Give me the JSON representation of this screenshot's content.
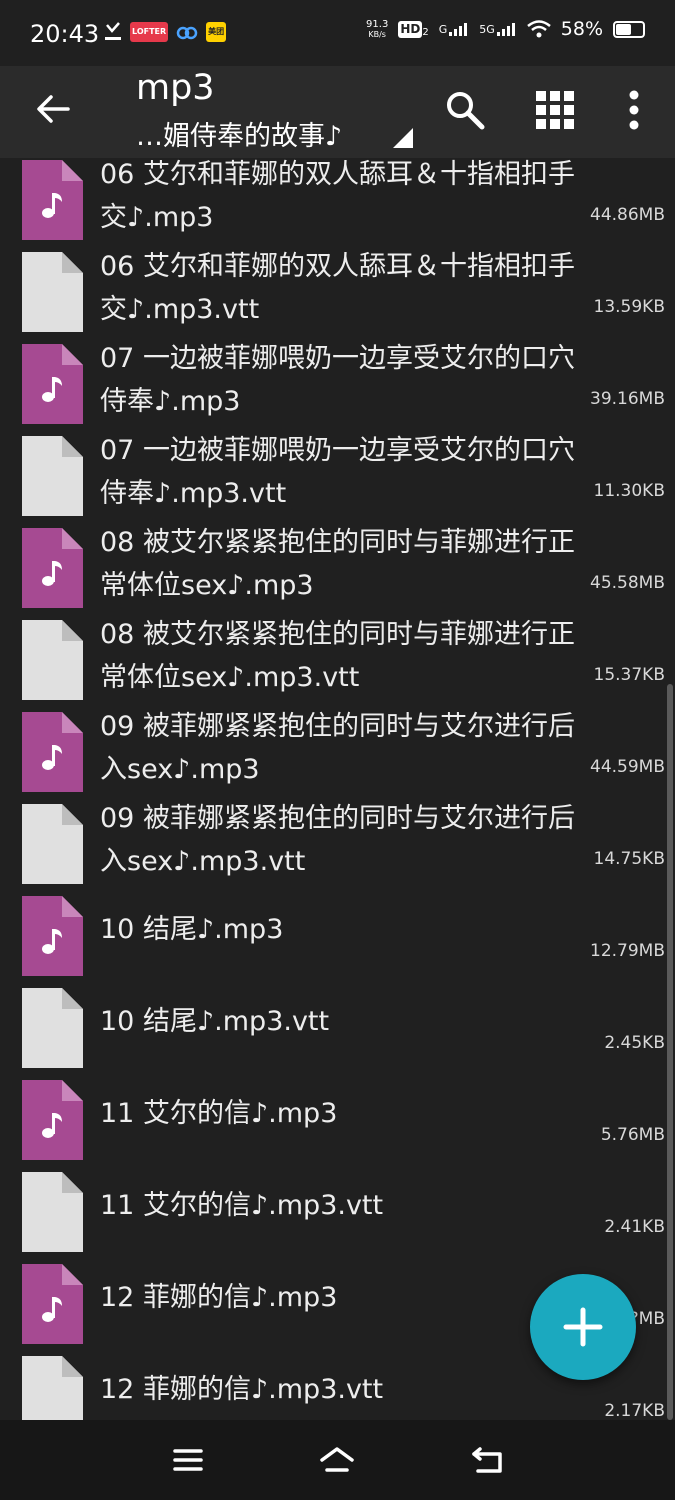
{
  "status_bar": {
    "time": "20:43",
    "net_speed_value": "91.3",
    "net_speed_unit": "KB/s",
    "hd_label": "HD",
    "hd_sub": "2",
    "sig1_label": "G",
    "sig2_label": "5G",
    "battery_percent": "58%",
    "battery_level": 0.58,
    "badges": [
      "LOFTER",
      "美团"
    ]
  },
  "app_bar": {
    "title": "mp3",
    "subtitle": "…媚侍奉的故事♪"
  },
  "files": [
    {
      "name": "06 艾尔和菲娜的双人舔耳＆十指相扣手交♪.mp3",
      "size": "44.86MB",
      "type": "audio"
    },
    {
      "name": "06 艾尔和菲娜的双人舔耳＆十指相扣手交♪.mp3.vtt",
      "size": "13.59KB",
      "type": "document"
    },
    {
      "name": "07 一边被菲娜喂奶一边享受艾尔的口穴侍奉♪.mp3",
      "size": "39.16MB",
      "type": "audio"
    },
    {
      "name": "07 一边被菲娜喂奶一边享受艾尔的口穴侍奉♪.mp3.vtt",
      "size": "11.30KB",
      "type": "document"
    },
    {
      "name": "08 被艾尔紧紧抱住的同时与菲娜进行正常体位sex♪.mp3",
      "size": "45.58MB",
      "type": "audio"
    },
    {
      "name": "08 被艾尔紧紧抱住的同时与菲娜进行正常体位sex♪.mp3.vtt",
      "size": "15.37KB",
      "type": "document"
    },
    {
      "name": "09 被菲娜紧紧抱住的同时与艾尔进行后入sex♪.mp3",
      "size": "44.59MB",
      "type": "audio"
    },
    {
      "name": "09 被菲娜紧紧抱住的同时与艾尔进行后入sex♪.mp3.vtt",
      "size": "14.75KB",
      "type": "document"
    },
    {
      "name": "10 结尾♪.mp3",
      "size": "12.79MB",
      "type": "audio"
    },
    {
      "name": "10 结尾♪.mp3.vtt",
      "size": "2.45KB",
      "type": "document"
    },
    {
      "name": "11 艾尔的信♪.mp3",
      "size": "5.76MB",
      "type": "audio"
    },
    {
      "name": "11 艾尔的信♪.mp3.vtt",
      "size": "2.41KB",
      "type": "document"
    },
    {
      "name": "12 菲娜的信♪.mp3",
      "size": "?.??MB",
      "type": "audio"
    },
    {
      "name": "12 菲娜的信♪.mp3.vtt",
      "size": "2.17KB",
      "type": "document"
    }
  ],
  "colors": {
    "audio_icon": "#a64a92",
    "audio_icon_fold": "#c986bb",
    "document_icon": "#e0e0e0",
    "document_icon_fold": "#bdbdbd",
    "fab": "#1ba9bf",
    "background": "#202020",
    "app_bar": "#2b2b2b"
  },
  "icons": {
    "back": "arrow-left-icon",
    "search": "search-icon",
    "grid": "grid-view-icon",
    "more": "more-vertical-icon",
    "fab": "plus-icon",
    "nav_menu": "menu-icon",
    "nav_home": "home-icon",
    "nav_back": "back-icon"
  }
}
